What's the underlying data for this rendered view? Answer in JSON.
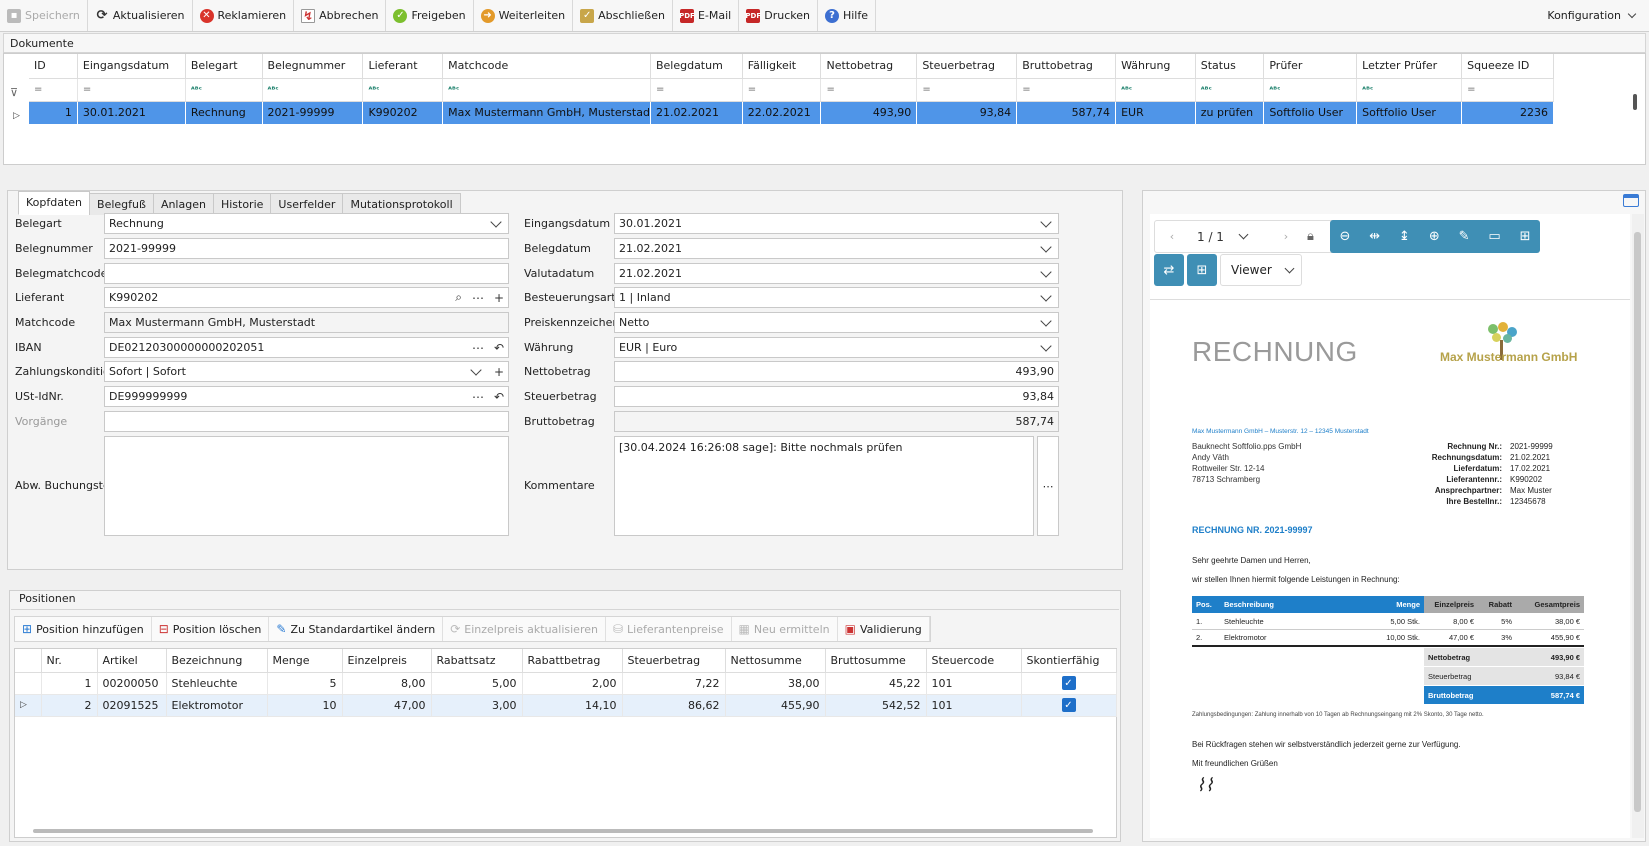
{
  "toolbar": {
    "buttons": [
      {
        "label": "Speichern",
        "icon": "floppy-icon",
        "enabled": false
      },
      {
        "label": "Aktualisieren",
        "icon": "refresh-icon",
        "enabled": true
      },
      {
        "label": "Reklamieren",
        "icon": "error-circle-icon",
        "enabled": true
      },
      {
        "label": "Abbrechen",
        "icon": "chart-cancel-icon",
        "enabled": true
      },
      {
        "label": "Freigeben",
        "icon": "check-circle-icon",
        "enabled": true
      },
      {
        "label": "Weiterleiten",
        "icon": "forward-icon",
        "enabled": true
      },
      {
        "label": "Abschließen",
        "icon": "clipboard-check-icon",
        "enabled": true
      },
      {
        "label": "E-Mail",
        "icon": "pdf-mail-icon",
        "enabled": true
      },
      {
        "label": "Drucken",
        "icon": "pdf-print-icon",
        "enabled": true
      },
      {
        "label": "Hilfe",
        "icon": "help-icon",
        "enabled": true
      }
    ],
    "config_label": "Konfiguration"
  },
  "documents": {
    "group_label": "Dokumente",
    "columns": [
      "ID",
      "Eingangsdatum",
      "Belegart",
      "Belegnummer",
      "Lieferant",
      "Matchcode",
      "Belegdatum",
      "Fälligkeit",
      "Nettobetrag",
      "Steuerbetrag",
      "Bruttobetrag",
      "Währung",
      "Status",
      "Prüfer",
      "Letzter Prüfer",
      "Squeeze ID"
    ],
    "row": [
      "1",
      "30.01.2021",
      "Rechnung",
      "2021-99999",
      "K990202",
      "Max Mustermann GmbH, Musterstadt",
      "21.02.2021",
      "22.02.2021",
      "493,90",
      "93,84",
      "587,74",
      "EUR",
      "zu prüfen",
      "Softfolio User",
      "Softfolio User",
      "2236"
    ]
  },
  "tabs": [
    "Kopfdaten",
    "Belegfuß",
    "Anlagen",
    "Historie",
    "Userfelder",
    "Mutationsprotokoll"
  ],
  "form_left": [
    {
      "label": "Belegart",
      "value": "Rechnung"
    },
    {
      "label": "Belegnummer",
      "value": "2021-99999"
    },
    {
      "label": "Belegmatchcode",
      "value": ""
    },
    {
      "label": "Lieferant",
      "value": "K990202"
    },
    {
      "label": "Matchcode",
      "value": "Max Mustermann GmbH, Musterstadt"
    },
    {
      "label": "IBAN",
      "value": "DE02120300000000202051"
    },
    {
      "label": "Zahlungskondition",
      "value": "Sofort | Sofort"
    },
    {
      "label": "USt-IdNr.",
      "value": "DE999999999"
    },
    {
      "label": "Vorgänge",
      "value": ""
    },
    {
      "label": "Abw. Buchungstext",
      "value": ""
    }
  ],
  "form_right": [
    {
      "label": "Eingangsdatum",
      "value": "30.01.2021"
    },
    {
      "label": "Belegdatum",
      "value": "21.02.2021"
    },
    {
      "label": "Valutadatum",
      "value": "21.02.2021"
    },
    {
      "label": "Besteuerungsart",
      "value": "1 | Inland"
    },
    {
      "label": "Preiskennzeichen",
      "value": "Netto"
    },
    {
      "label": "Währung",
      "value": "EUR | Euro"
    },
    {
      "label": "Nettobetrag",
      "value": "493,90"
    },
    {
      "label": "Steuerbetrag",
      "value": "93,84"
    },
    {
      "label": "Bruttobetrag",
      "value": "587,74"
    },
    {
      "label": "Kommentare",
      "value": "[30.04.2024 16:26:08 sage]: Bitte nochmals prüfen"
    }
  ],
  "positions": {
    "group_label": "Positionen",
    "toolbar": [
      {
        "label": "Position hinzufügen",
        "enabled": true
      },
      {
        "label": "Position löschen",
        "enabled": true
      },
      {
        "label": "Zu Standardartikel ändern",
        "enabled": true
      },
      {
        "label": "Einzelpreis aktualisieren",
        "enabled": false
      },
      {
        "label": "Lieferantenpreise",
        "enabled": false
      },
      {
        "label": "Neu ermitteln",
        "enabled": false
      },
      {
        "label": "Validierung",
        "enabled": true
      }
    ],
    "columns": [
      "Nr.",
      "Artikel",
      "Bezeichnung",
      "Menge",
      "Einzelpreis",
      "Rabattsatz",
      "Rabattbetrag",
      "Steuerbetrag",
      "Nettosumme",
      "Bruttosumme",
      "Steuercode",
      "Skontierfähig"
    ],
    "rows": [
      [
        "1",
        "00200050",
        "Stehleuchte",
        "5",
        "8,00",
        "5,00",
        "2,00",
        "7,22",
        "38,00",
        "45,22",
        "101"
      ],
      [
        "2",
        "02091525",
        "Elektromotor",
        "10",
        "47,00",
        "3,00",
        "14,10",
        "86,62",
        "455,90",
        "542,52",
        "101"
      ]
    ]
  },
  "viewer": {
    "page": "1 / 1",
    "mode": "Viewer"
  },
  "invoice": {
    "title": "RECHNUNG",
    "brand": "Max Mustermann GmbH",
    "sender_line": "Max Mustermann GmbH – Musterstr. 12 – 12345 Musterstadt",
    "address": [
      "Bauknecht Softfolio.pps GmbH",
      "Andy Väth",
      "Rottweiler Str. 12-14",
      "78713 Schramberg"
    ],
    "meta": [
      {
        "k": "Rechnung Nr.:",
        "v": "2021-99999"
      },
      {
        "k": "Rechnungsdatum:",
        "v": "21.02.2021"
      },
      {
        "k": "Lieferdatum:",
        "v": "17.02.2021"
      },
      {
        "k": "Lieferantennr.:",
        "v": "K990202"
      },
      {
        "k": "Ansprechpartner:",
        "v": "Max Muster"
      },
      {
        "k": "Ihre Bestellnr.:",
        "v": "12345678"
      }
    ],
    "heading": "RECHNUNG NR. 2021-99997",
    "greeting": "Sehr geehrte Damen und Herren,",
    "intro": "wir stellen Ihnen hiermit folgende Leistungen in Rechnung:",
    "table_header": [
      "Pos.",
      "Beschreibung",
      "Menge",
      "Einzelpreis",
      "Rabatt",
      "Gesamtpreis"
    ],
    "table_rows": [
      [
        "1.",
        "Stehleuchte",
        "5,00 Stk.",
        "8,00 €",
        "5%",
        "38,00 €"
      ],
      [
        "2.",
        "Elektromotor",
        "10,00 Stk.",
        "47,00 €",
        "3%",
        "455,90 €"
      ]
    ],
    "totals": [
      {
        "k": "Nettobetrag",
        "v": "493,90 €"
      },
      {
        "k": "Steuerbetrag",
        "v": "93,84 €"
      },
      {
        "k": "Bruttobetrag",
        "v": "587,74 €"
      }
    ],
    "terms": "Zahlungsbedingungen: Zahlung innerhalb von 10 Tagen ab Rechnungseingang mit 2% Skonto, 30 Tage netto.",
    "closing": "Bei Rückfragen stehen wir selbstverständlich jederzeit gerne zur Verfügung.",
    "regards": "Mit freundlichen Grüßen"
  },
  "colors": {
    "accent": "#4f95e8",
    "viewer_btn": "#3f8fb5",
    "invoice_blue": "#1e7fc9"
  }
}
